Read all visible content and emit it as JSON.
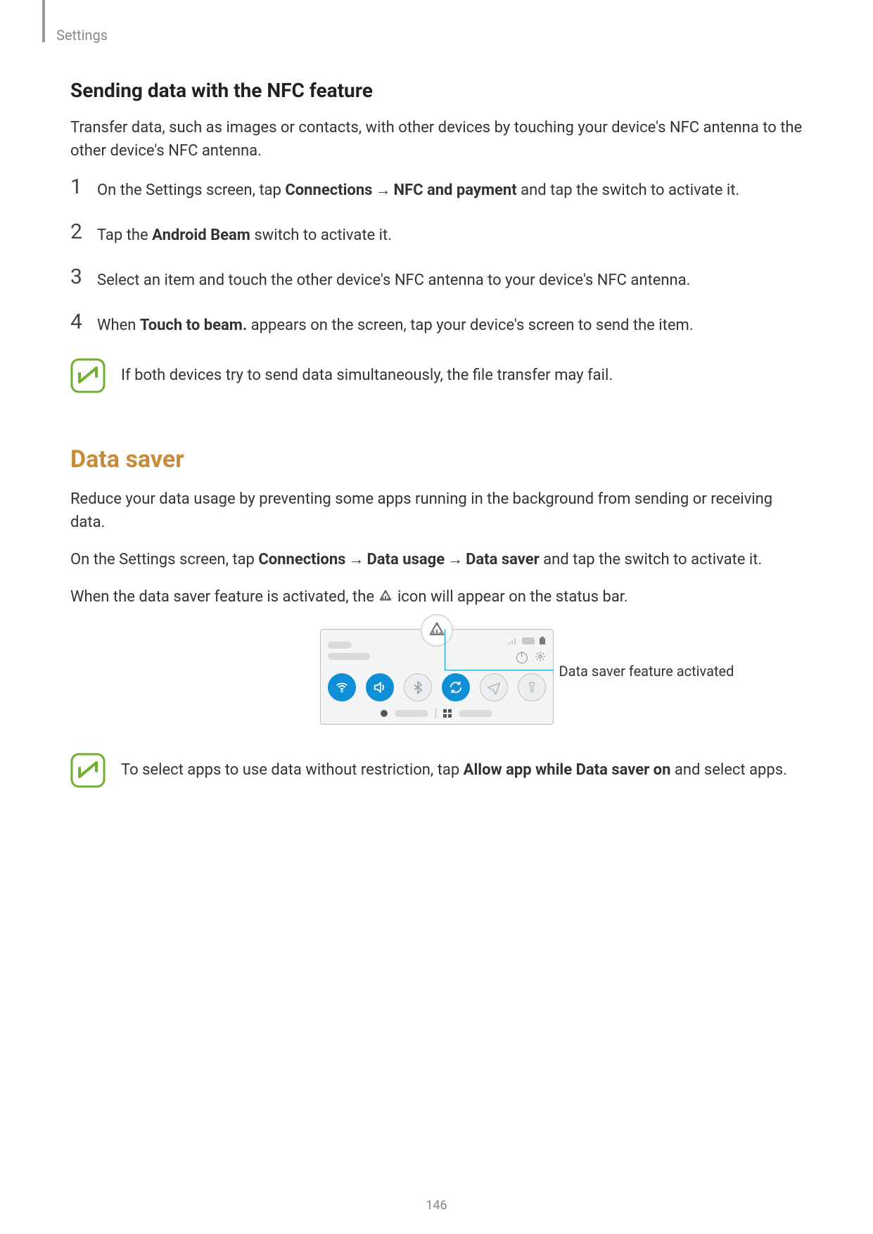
{
  "breadcrumb": "Settings",
  "nfc": {
    "heading": "Sending data with the NFC feature",
    "intro": "Transfer data, such as images or contacts, with other devices by touching your device's NFC antenna to the other device's NFC antenna.",
    "steps": {
      "s1_a": "On the Settings screen, tap ",
      "s1_b1": "Connections",
      "s1_b2": "NFC and payment",
      "s1_c": " and tap the switch to activate it.",
      "s2_a": "Tap the ",
      "s2_b": "Android Beam",
      "s2_c": " switch to activate it.",
      "s3": "Select an item and touch the other device's NFC antenna to your device's NFC antenna.",
      "s4_a": "When ",
      "s4_b": "Touch to beam.",
      "s4_c": " appears on the screen, tap your device's screen to send the item."
    },
    "note": "If both devices try to send data simultaneously, the file transfer may fail."
  },
  "datasaver": {
    "heading": "Data saver",
    "p1": "Reduce your data usage by preventing some apps running in the background from sending or receiving data.",
    "p2_a": "On the Settings screen, tap ",
    "p2_b1": "Connections",
    "p2_b2": "Data usage",
    "p2_b3": "Data saver",
    "p2_c": " and tap the switch to activate it.",
    "p3_a": "When the data saver feature is activated, the ",
    "p3_b": " icon will appear on the status bar.",
    "callout": "Data saver feature activated",
    "note_a": "To select apps to use data without restriction, tap ",
    "note_b": "Allow app while Data saver on",
    "note_c": " and select apps."
  },
  "nums": {
    "n1": "1",
    "n2": "2",
    "n3": "3",
    "n4": "4"
  },
  "arrow": "→",
  "page_number": "146"
}
